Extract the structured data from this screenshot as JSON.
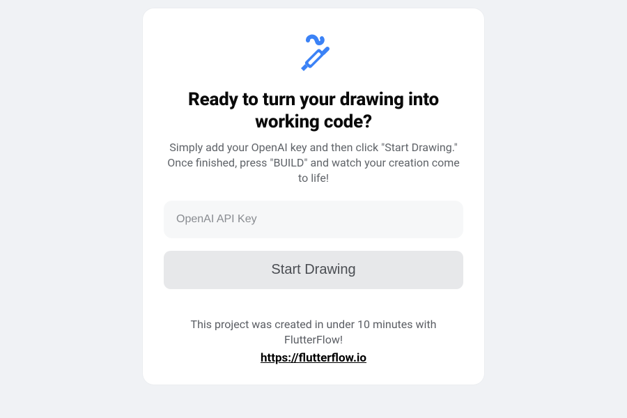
{
  "card": {
    "heading": "Ready to turn your drawing into working code?",
    "subtext": "Simply add your OpenAI key and then click \"Start Drawing.\" Once finished, press \"BUILD\" and watch your creation come to life!",
    "api_key_placeholder": "OpenAI API Key",
    "api_key_value": "",
    "start_button_label": "Start Drawing",
    "footer_text": "This project was created in under 10 minutes with FlutterFlow!",
    "footer_link_text": "https://flutterflow.io"
  },
  "colors": {
    "accent": "#3b82f6",
    "background": "#f0f2f5",
    "card_bg": "#ffffff",
    "button_bg": "#e7e8ea",
    "text_muted": "#5f6368"
  }
}
